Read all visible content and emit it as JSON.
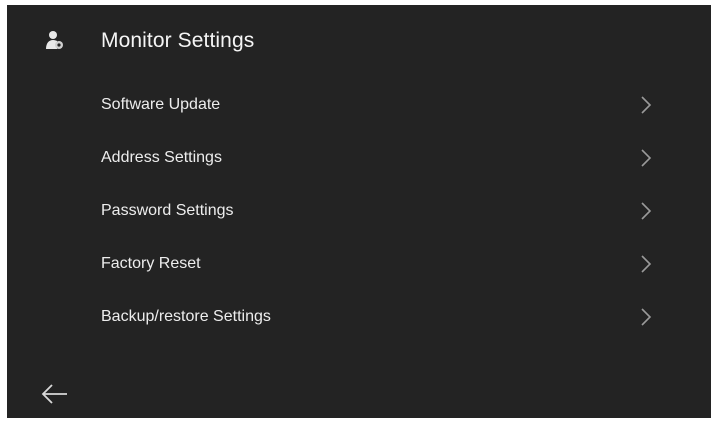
{
  "header": {
    "icon": "user-settings-icon",
    "title": "Monitor Settings"
  },
  "menu": {
    "items": [
      {
        "label": "Software Update",
        "icon": "chevron-right-icon"
      },
      {
        "label": "Address Settings",
        "icon": "chevron-right-icon"
      },
      {
        "label": "Password Settings",
        "icon": "chevron-right-icon"
      },
      {
        "label": "Factory Reset",
        "icon": "chevron-right-icon"
      },
      {
        "label": "Backup/restore Settings",
        "icon": "chevron-right-icon"
      }
    ]
  },
  "footer": {
    "back_icon": "back-arrow-icon"
  },
  "colors": {
    "background": "#232323",
    "text": "#f2f2f2",
    "chevron": "#9a9a9a"
  }
}
